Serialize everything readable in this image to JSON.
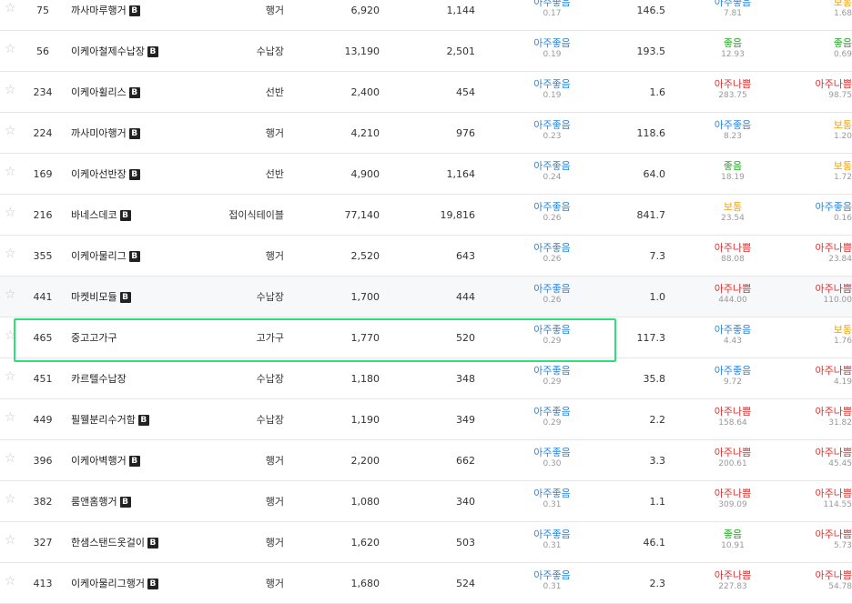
{
  "status_colors": {
    "아주좋음": "#2e86de",
    "좋음": "#22aa22",
    "보통": "#f5a300",
    "아주나쁨": "#e0302e"
  },
  "badge_label": "B",
  "star_glyph": "☆",
  "highlighted_rank": "465",
  "rows": [
    {
      "rank": "75",
      "name": "까사마루행거",
      "badge": true,
      "category": "행거",
      "n1": "6,920",
      "n2": "1,144",
      "s1_label": "아주좋음",
      "s1_value": "0.17",
      "n3": "146.5",
      "s2_label": "아주좋음",
      "s2_value": "7.81",
      "s3_label": "보통",
      "s3_value": "1.68"
    },
    {
      "rank": "56",
      "name": "이케아철제수납장",
      "badge": true,
      "category": "수납장",
      "n1": "13,190",
      "n2": "2,501",
      "s1_label": "아주좋음",
      "s1_value": "0.19",
      "n3": "193.5",
      "s2_label": "좋음",
      "s2_value": "12.93",
      "s3_label": "좋음",
      "s3_value": "0.69"
    },
    {
      "rank": "234",
      "name": "이케아휠리스",
      "badge": true,
      "category": "선반",
      "n1": "2,400",
      "n2": "454",
      "s1_label": "아주좋음",
      "s1_value": "0.19",
      "n3": "1.6",
      "s2_label": "아주나쁨",
      "s2_value": "283.75",
      "s3_label": "아주나쁨",
      "s3_value": "98.75"
    },
    {
      "rank": "224",
      "name": "까사미아행거",
      "badge": true,
      "category": "행거",
      "n1": "4,210",
      "n2": "976",
      "s1_label": "아주좋음",
      "s1_value": "0.23",
      "n3": "118.6",
      "s2_label": "아주좋음",
      "s2_value": "8.23",
      "s3_label": "보통",
      "s3_value": "1.20"
    },
    {
      "rank": "169",
      "name": "이케아선반장",
      "badge": true,
      "category": "선반",
      "n1": "4,900",
      "n2": "1,164",
      "s1_label": "아주좋음",
      "s1_value": "0.24",
      "n3": "64.0",
      "s2_label": "좋음",
      "s2_value": "18.19",
      "s3_label": "보통",
      "s3_value": "1.72"
    },
    {
      "rank": "216",
      "name": "바네스데코",
      "badge": true,
      "category": "접이식테이블",
      "n1": "77,140",
      "n2": "19,816",
      "s1_label": "아주좋음",
      "s1_value": "0.26",
      "n3": "841.7",
      "s2_label": "보통",
      "s2_value": "23.54",
      "s3_label": "아주좋음",
      "s3_value": "0.16"
    },
    {
      "rank": "355",
      "name": "이케아물리그",
      "badge": true,
      "category": "행거",
      "n1": "2,520",
      "n2": "643",
      "s1_label": "아주좋음",
      "s1_value": "0.26",
      "n3": "7.3",
      "s2_label": "아주나쁨",
      "s2_value": "88.08",
      "s3_label": "아주나쁨",
      "s3_value": "23.84"
    },
    {
      "rank": "441",
      "name": "마켓비모듈",
      "badge": true,
      "category": "수납장",
      "n1": "1,700",
      "n2": "444",
      "s1_label": "아주좋음",
      "s1_value": "0.26",
      "n3": "1.0",
      "s2_label": "아주나쁨",
      "s2_value": "444.00",
      "s3_label": "아주나쁨",
      "s3_value": "110.00",
      "alt": true
    },
    {
      "rank": "465",
      "name": "중고고가구",
      "badge": false,
      "category": "고가구",
      "n1": "1,770",
      "n2": "520",
      "s1_label": "아주좋음",
      "s1_value": "0.29",
      "n3": "117.3",
      "s2_label": "아주좋음",
      "s2_value": "4.43",
      "s3_label": "보통",
      "s3_value": "1.76"
    },
    {
      "rank": "451",
      "name": "카르텔수납장",
      "badge": false,
      "category": "수납장",
      "n1": "1,180",
      "n2": "348",
      "s1_label": "아주좋음",
      "s1_value": "0.29",
      "n3": "35.8",
      "s2_label": "아주좋음",
      "s2_value": "9.72",
      "s3_label": "아주나쁨",
      "s3_value": "4.19"
    },
    {
      "rank": "449",
      "name": "필웰분리수거함",
      "badge": true,
      "category": "수납장",
      "n1": "1,190",
      "n2": "349",
      "s1_label": "아주좋음",
      "s1_value": "0.29",
      "n3": "2.2",
      "s2_label": "아주나쁨",
      "s2_value": "158.64",
      "s3_label": "아주나쁨",
      "s3_value": "31.82"
    },
    {
      "rank": "396",
      "name": "이케아벽행거",
      "badge": true,
      "category": "행거",
      "n1": "2,200",
      "n2": "662",
      "s1_label": "아주좋음",
      "s1_value": "0.30",
      "n3": "3.3",
      "s2_label": "아주나쁨",
      "s2_value": "200.61",
      "s3_label": "아주나쁨",
      "s3_value": "45.45"
    },
    {
      "rank": "382",
      "name": "룸앤홈행거",
      "badge": true,
      "category": "행거",
      "n1": "1,080",
      "n2": "340",
      "s1_label": "아주좋음",
      "s1_value": "0.31",
      "n3": "1.1",
      "s2_label": "아주나쁨",
      "s2_value": "309.09",
      "s3_label": "아주나쁨",
      "s3_value": "114.55"
    },
    {
      "rank": "327",
      "name": "한샘스탠드옷걸이",
      "badge": true,
      "category": "행거",
      "n1": "1,620",
      "n2": "503",
      "s1_label": "아주좋음",
      "s1_value": "0.31",
      "n3": "46.1",
      "s2_label": "좋음",
      "s2_value": "10.91",
      "s3_label": "아주나쁨",
      "s3_value": "5.73"
    },
    {
      "rank": "413",
      "name": "이케아물리그행거",
      "badge": true,
      "category": "행거",
      "n1": "1,680",
      "n2": "524",
      "s1_label": "아주좋음",
      "s1_value": "0.31",
      "n3": "2.3",
      "s2_label": "아주나쁨",
      "s2_value": "227.83",
      "s3_label": "아주나쁨",
      "s3_value": "54.78"
    }
  ]
}
